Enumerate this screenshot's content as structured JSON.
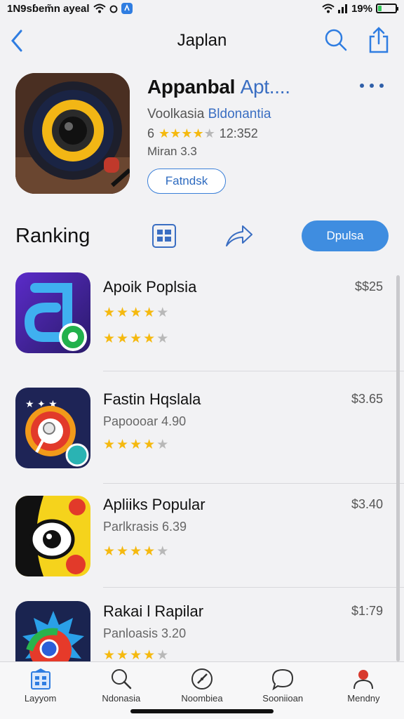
{
  "status_bar": {
    "left_text": "1N9sɓem̃n ayeal",
    "battery_text": "19%",
    "battery_level": 0.19
  },
  "nav": {
    "title": "Japlan",
    "icons": [
      "chevron-left-icon",
      "search-icon",
      "share-icon"
    ]
  },
  "app": {
    "title": "Appanbal",
    "title_suffix": "Apt....",
    "developer": "Voolkasia",
    "developer_link": "Bldonantia",
    "rating_prefix": "6",
    "rating": 3.5,
    "rating_count": "12:352",
    "extra": "Miran 3.3",
    "action_label": "Fatndsk"
  },
  "ranking": {
    "title": "Ranking",
    "button_label": "Dpulsa"
  },
  "apps": [
    {
      "name": "Apoik Poplsia",
      "price": "$$25",
      "subtitle": "",
      "stars": [
        4,
        3.5
      ]
    },
    {
      "name": "Fastin Hqslala",
      "price": "$3.65",
      "subtitle": "Papoooar 4.90",
      "stars": [
        4
      ]
    },
    {
      "name": "Apliiks Popular",
      "price": "$3.40",
      "subtitle": "Parlkrasis 6.39",
      "stars": [
        4
      ]
    },
    {
      "name": "Rakai l Rapilar",
      "price": "$1:79",
      "subtitle": "Panloasis 3.20",
      "stars": [
        4
      ]
    }
  ],
  "tabs": [
    {
      "label": "Layyom",
      "icon": "apps-grid-icon",
      "active": true
    },
    {
      "label": "Ndonasia",
      "icon": "search-icon",
      "active": false
    },
    {
      "label": "Noombiea",
      "icon": "compass-icon",
      "active": false
    },
    {
      "label": "Sooniioan",
      "icon": "chat-bubble-icon",
      "active": false
    },
    {
      "label": "Mendny",
      "icon": "profile-icon",
      "active": false
    }
  ],
  "colors": {
    "accent": "#3f8de0",
    "link": "#3a6ec2",
    "star": "#f5b90f",
    "star_off": "#b8b8b8",
    "profile_red": "#d83a2e"
  }
}
